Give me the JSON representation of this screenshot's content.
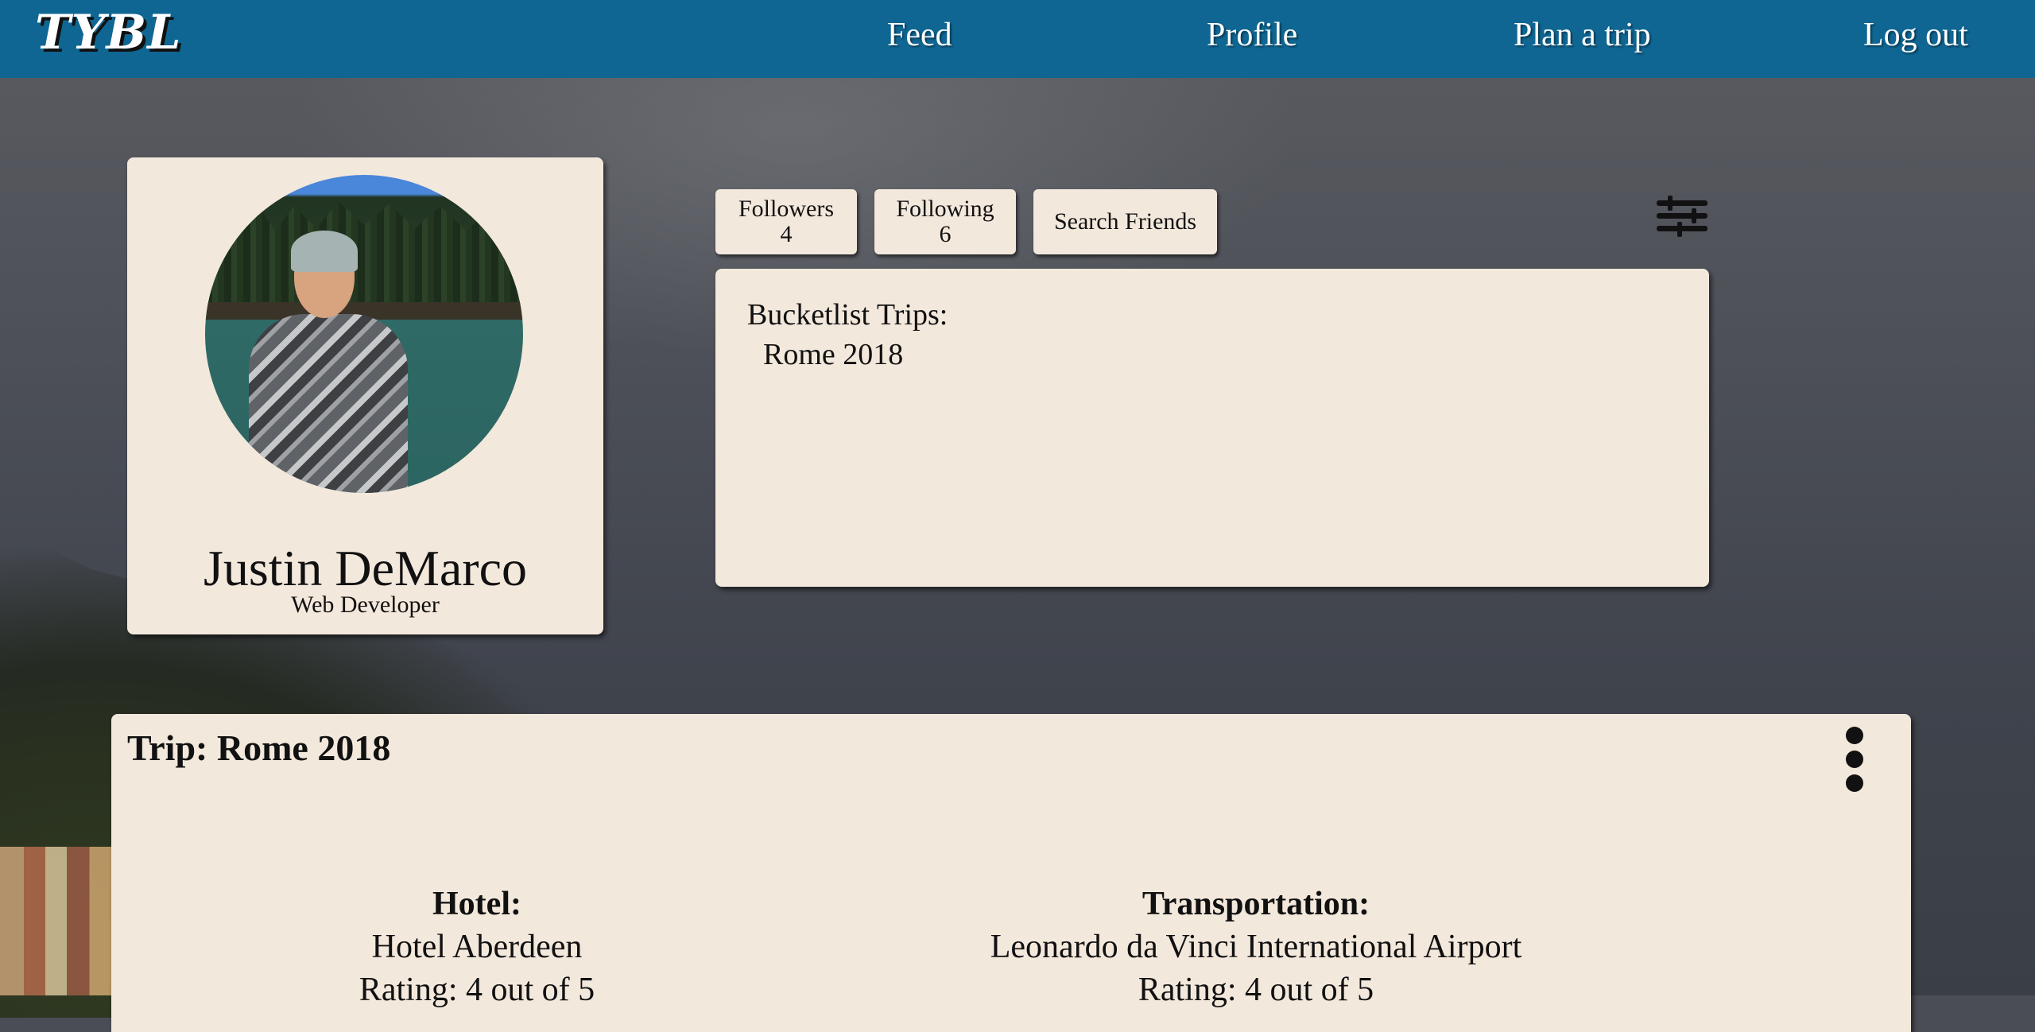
{
  "nav": {
    "logo": "TYBL",
    "links": [
      "Feed",
      "Profile",
      "Plan a trip",
      "Log out"
    ]
  },
  "profile": {
    "name": "Justin DeMarco",
    "title": "Web Developer"
  },
  "social": {
    "followers_label": "Followers",
    "followers_count": "4",
    "following_label": "Following",
    "following_count": "6",
    "search_label": "Search Friends"
  },
  "bucketlist": {
    "heading": "Bucketlist Trips:",
    "items": [
      "Rome 2018"
    ]
  },
  "trip": {
    "title": "Trip: Rome 2018",
    "hotel": {
      "heading": "Hotel:",
      "name": "Hotel Aberdeen",
      "rating": "Rating: 4 out of 5"
    },
    "transportation": {
      "heading": "Transportation:",
      "name": "Leonardo da Vinci International Airport",
      "rating": "Rating: 4 out of 5"
    }
  },
  "icons": {
    "filter": "sliders-icon",
    "more": "kebab-menu-icon"
  },
  "colors": {
    "navbar": "#0f6693",
    "card": "#f3e8dc"
  }
}
